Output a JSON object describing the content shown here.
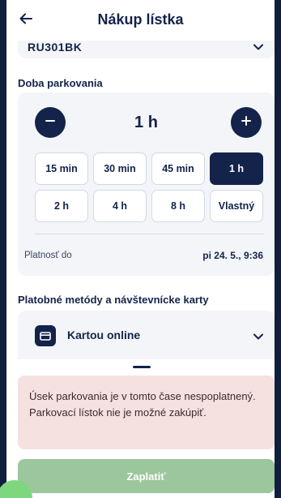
{
  "header": {
    "title": "Nákup lístka",
    "back_icon": "arrow-left-icon"
  },
  "vehicle": {
    "plate": "RU301BK"
  },
  "duration": {
    "section_label": "Doba parkovania",
    "current_value": "1 h",
    "decrease_icon": "minus-icon",
    "increase_icon": "plus-icon",
    "options": [
      "15 min",
      "30 min",
      "45 min",
      "1 h",
      "2 h",
      "4 h",
      "8 h",
      "Vlastný"
    ],
    "selected": "1 h",
    "valid_until_label": "Platnosť do",
    "valid_until_value": "pi 24. 5., 9:36"
  },
  "payment": {
    "section_label": "Platobné metódy a návštevnícke karty",
    "method": "Kartou online",
    "method_icon": "credit-card-icon"
  },
  "alert": {
    "message": "Úsek parkovania je v tomto čase nespoplatnený. Parkovací lístok nie je možné zakúpiť."
  },
  "actions": {
    "pay_label": "Zaplatiť"
  },
  "colors": {
    "primary": "#13234a",
    "card_bg": "#f3f5f8",
    "alert_bg": "#f6e1e1",
    "pay_disabled": "#9cc69b",
    "backdrop": "#0f1f3d"
  }
}
